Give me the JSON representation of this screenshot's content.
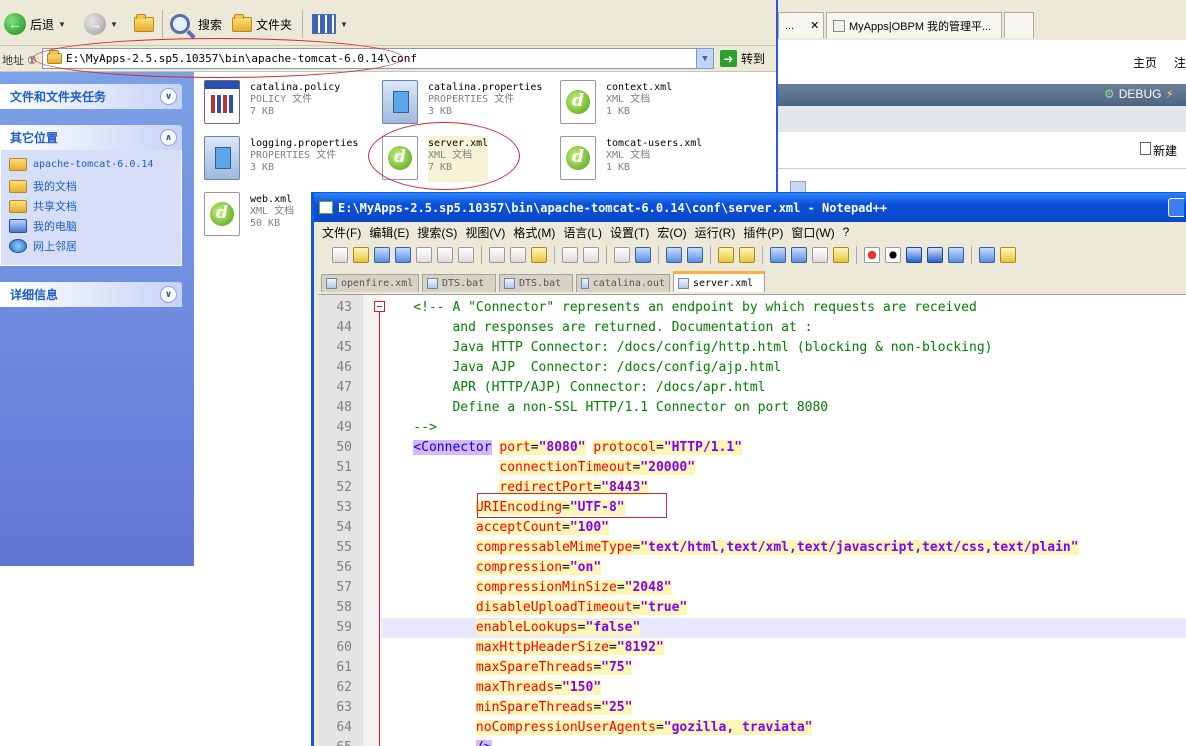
{
  "explorer": {
    "toolbar": {
      "back_label": "后退",
      "search_label": "搜索",
      "folders_label": "文件夹"
    },
    "address": {
      "label": "地址 ①",
      "path": "E:\\MyApps-2.5.sp5.10357\\bin\\apache-tomcat-6.0.14\\conf",
      "go_label": "转到"
    },
    "left_panel": {
      "tasks_title": "文件和文件夹任务",
      "places_title": "其它位置",
      "places": [
        "apache-tomcat-6.0.14",
        "我的文档",
        "共享文档",
        "我的电脑",
        "网上邻居"
      ],
      "details_title": "详细信息"
    },
    "files": [
      {
        "name": "catalina.policy",
        "type": "POLICY 文件",
        "size": "7 KB",
        "icon": "policy-file-icon"
      },
      {
        "name": "catalina.properties",
        "type": "PROPERTIES 文件",
        "size": "3 KB",
        "icon": "properties-file-icon"
      },
      {
        "name": "context.xml",
        "type": "XML 文档",
        "size": "1 KB",
        "icon": "dreamweaver-xml-icon"
      },
      {
        "name": "logging.properties",
        "type": "PROPERTIES 文件",
        "size": "3 KB",
        "icon": "properties-file-icon"
      },
      {
        "name": "server.xml",
        "type": "XML 文档",
        "size": "7 KB",
        "icon": "dreamweaver-xml-icon"
      },
      {
        "name": "tomcat-users.xml",
        "type": "XML 文档",
        "size": "1 KB",
        "icon": "dreamweaver-xml-icon"
      },
      {
        "name": "web.xml",
        "type": "XML 文档",
        "size": "50 KB",
        "icon": "dreamweaver-xml-icon"
      }
    ]
  },
  "browser": {
    "tab1_label": "...",
    "tab2_label": "MyApps|OBPM 我的管理平...",
    "home_label": "主页",
    "zhu_label": "注",
    "debug_label": "DEBUG",
    "new_label": "新建"
  },
  "notepad": {
    "title": "E:\\MyApps-2.5.sp5.10357\\bin\\apache-tomcat-6.0.14\\conf\\server.xml - Notepad++",
    "menu": [
      "文件(F)",
      "编辑(E)",
      "搜索(S)",
      "视图(V)",
      "格式(M)",
      "语言(L)",
      "设置(T)",
      "宏(O)",
      "运行(R)",
      "插件(P)",
      "窗口(W)",
      "?"
    ],
    "tabs": [
      "openfire.xml",
      "DTS.bat",
      "DTS.bat",
      "catalina.out",
      "server.xml"
    ],
    "active_tab": "server.xml",
    "current_line": 59,
    "lines": [
      {
        "n": "43",
        "text": "    <!-- A \"Connector\" represents an endpoint by which requests are received"
      },
      {
        "n": "44",
        "text": "         and responses are returned. Documentation at :"
      },
      {
        "n": "45",
        "text": "         Java HTTP Connector: /docs/config/http.html (blocking & non-blocking)"
      },
      {
        "n": "46",
        "text": "         Java AJP  Connector: /docs/config/ajp.html"
      },
      {
        "n": "47",
        "text": "         APR (HTTP/AJP) Connector: /docs/apr.html"
      },
      {
        "n": "48",
        "text": "         Define a non-SSL HTTP/1.1 Connector on port 8080"
      },
      {
        "n": "49",
        "text": "    -->"
      },
      {
        "n": "50",
        "tag": "<Connector",
        "attr": "port",
        "value": "\"8080\"",
        "attr2": "protocol",
        "value2": "\"HTTP/1.1\""
      },
      {
        "n": "51",
        "indent": "               ",
        "attr": "connectionTimeout",
        "value": "\"20000\""
      },
      {
        "n": "52",
        "indent": "               ",
        "attr": "redirectPort",
        "value": "\"8443\""
      },
      {
        "n": "53",
        "indent": "            ",
        "attr": "URIEncoding",
        "value": "\"UTF-8\""
      },
      {
        "n": "54",
        "indent": "            ",
        "attr": "acceptCount",
        "value": "\"100\""
      },
      {
        "n": "55",
        "indent": "            ",
        "attr": "compressableMimeType",
        "value": "\"text/html,text/xml,text/javascript,text/css,text/plain\""
      },
      {
        "n": "56",
        "indent": "            ",
        "attr": "compression",
        "value": "\"on\""
      },
      {
        "n": "57",
        "indent": "            ",
        "attr": "compressionMinSize",
        "value": "\"2048\""
      },
      {
        "n": "58",
        "indent": "            ",
        "attr": "disableUploadTimeout",
        "value": "\"true\""
      },
      {
        "n": "59",
        "indent": "            ",
        "attr": "enableLookups",
        "value": "\"false\""
      },
      {
        "n": "60",
        "indent": "            ",
        "attr": "maxHttpHeaderSize",
        "value": "\"8192\""
      },
      {
        "n": "61",
        "indent": "            ",
        "attr": "maxSpareThreads",
        "value": "\"75\""
      },
      {
        "n": "62",
        "indent": "            ",
        "attr": "maxThreads",
        "value": "\"150\""
      },
      {
        "n": "63",
        "indent": "            ",
        "attr": "minSpareThreads",
        "value": "\"25\""
      },
      {
        "n": "64",
        "indent": "            ",
        "attr": "noCompressionUserAgents",
        "value": "\"gozilla, traviata\""
      },
      {
        "n": "65",
        "indent": "            ",
        "tag": "/>"
      }
    ]
  }
}
